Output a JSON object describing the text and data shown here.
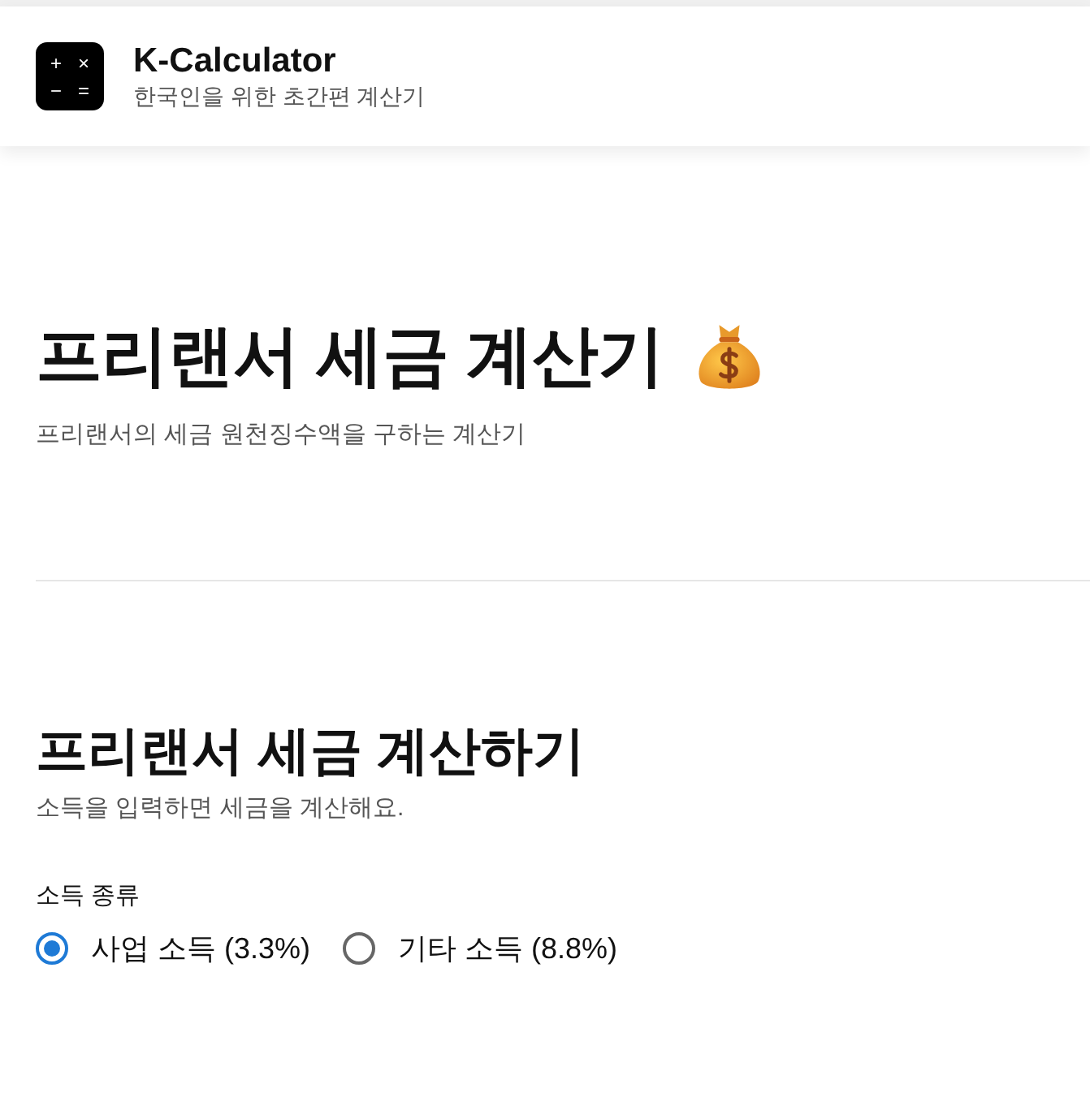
{
  "header": {
    "title": "K-Calculator",
    "subtitle": "한국인을 위한 초간편 계산기",
    "logo_keys": [
      "+",
      "×",
      "−",
      "="
    ]
  },
  "hero": {
    "title": "프리랜서 세금 계산기",
    "subtitle": "프리랜서의 세금 원천징수액을 구하는 계산기"
  },
  "section": {
    "title": "프리랜서 세금 계산하기",
    "subtitle": "소득을 입력하면 세금을 계산해요.",
    "field_label": "소득 종류",
    "options": [
      {
        "label": "사업 소득 (3.3%)",
        "selected": true
      },
      {
        "label": "기타 소득 (8.8%)",
        "selected": false
      }
    ]
  }
}
